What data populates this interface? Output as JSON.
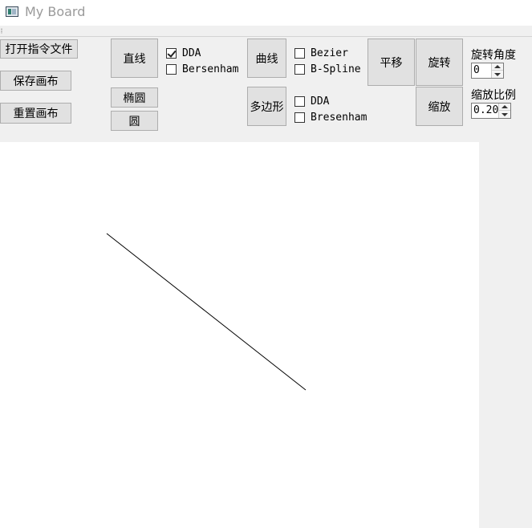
{
  "window": {
    "title": "My Board",
    "icon": "app-icon"
  },
  "toolbar": {
    "open_file": "打开指令文件",
    "save_canvas": "保存画布",
    "reset_canvas": "重置画布",
    "line": "直线",
    "ellipse": "椭圆",
    "circle": "圆",
    "curve": "曲线",
    "polygon": "多边形",
    "translate": "平移",
    "rotate": "旋转",
    "scale": "缩放",
    "line_algorithms": [
      {
        "label": "DDA",
        "checked": true
      },
      {
        "label": "Bersenham",
        "checked": false
      }
    ],
    "curve_algorithms": [
      {
        "label": "Bezier",
        "checked": false
      },
      {
        "label": "B-Spline",
        "checked": false
      }
    ],
    "polygon_algorithms": [
      {
        "label": "DDA",
        "checked": false
      },
      {
        "label": "Bresenham",
        "checked": false
      }
    ],
    "rotation_angle_label": "旋转角度",
    "rotation_angle_value": "0",
    "scale_ratio_label": "缩放比例",
    "scale_ratio_value": "0.20"
  },
  "canvas": {
    "background": "#ffffff",
    "stroke_color": "#000000"
  }
}
